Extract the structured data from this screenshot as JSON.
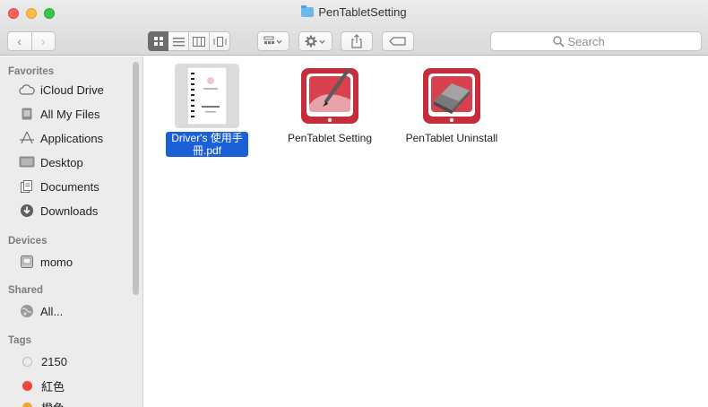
{
  "window": {
    "title": "PenTabletSetting"
  },
  "toolbar": {
    "back_glyph": "‹",
    "forward_glyph": "›",
    "view_modes": [
      "icon-view",
      "list-view",
      "column-view",
      "cover-flow-view"
    ],
    "search_placeholder": "Search"
  },
  "sidebar": {
    "sections": [
      {
        "title": "Favorites",
        "items": [
          {
            "label": "iCloud Drive",
            "icon": "cloud-icon"
          },
          {
            "label": "All My Files",
            "icon": "all-files-icon"
          },
          {
            "label": "Applications",
            "icon": "applications-icon"
          },
          {
            "label": "Desktop",
            "icon": "desktop-icon"
          },
          {
            "label": "Documents",
            "icon": "documents-icon"
          },
          {
            "label": "Downloads",
            "icon": "downloads-icon"
          }
        ]
      },
      {
        "title": "Devices",
        "items": [
          {
            "label": "momo",
            "icon": "disk-icon"
          }
        ]
      },
      {
        "title": "Shared",
        "items": [
          {
            "label": "All...",
            "icon": "network-icon"
          }
        ]
      },
      {
        "title": "Tags",
        "items": [
          {
            "label": "2150",
            "color": "#d6d6d6"
          },
          {
            "label": "紅色",
            "color": "#f5463f"
          },
          {
            "label": "橙色",
            "color": "#f5a623"
          }
        ]
      }
    ]
  },
  "files": [
    {
      "name": "Driver's 使用手冊.pdf",
      "icon": "pdf-document-icon",
      "selected": true
    },
    {
      "name": "PenTablet Setting",
      "icon": "pentablet-setting-app-icon",
      "selected": false
    },
    {
      "name": "PenTablet Uninstall",
      "icon": "pentablet-uninstall-app-icon",
      "selected": false
    }
  ],
  "colors": {
    "selection": "#1c60d8",
    "app_red": "#c42d3c"
  }
}
